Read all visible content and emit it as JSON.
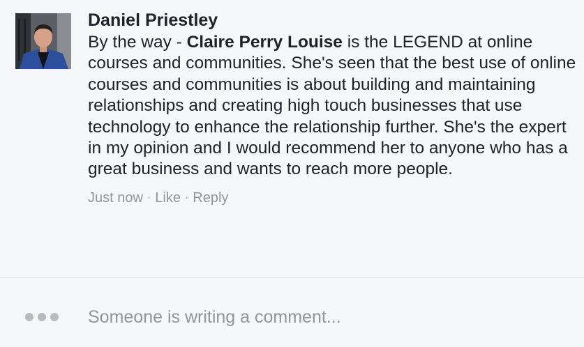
{
  "comment": {
    "author": "Daniel Priestley",
    "text_before": "By the way - ",
    "mention": "Claire Perry Louise",
    "text_after": " is the LEGEND at online courses and communities. She's seen that the best use of online courses and communities is about building and maintaining relationships and creating high touch businesses that use technology to enhance the relationship further. She's the expert in my opinion and I would recommend her to anyone who has a great business and wants to reach more people.",
    "timestamp": "Just now",
    "separator": "·",
    "like_label": "Like",
    "reply_label": "Reply"
  },
  "typing_indicator": {
    "text": "Someone is writing a comment...",
    "icon": "typing-dots-icon"
  },
  "colors": {
    "background": "#f6f7f9",
    "text": "#1d2129",
    "meta": "#90949c",
    "divider": "#e2e4e8",
    "dots": "#b7bac0"
  }
}
